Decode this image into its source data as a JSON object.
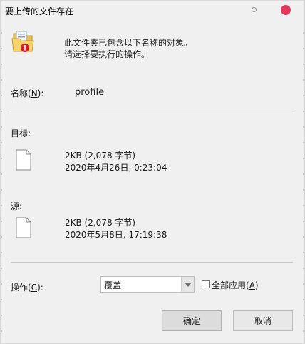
{
  "window": {
    "title": "要上传的文件存在",
    "close_color": "#e2385d"
  },
  "message": {
    "line1": "此文件夹已包含以下名称的对象。",
    "line2": "请选择要执行的操作。"
  },
  "name_row": {
    "label_prefix": "名称(",
    "label_key": "N",
    "label_suffix": "):",
    "value": "profile"
  },
  "target": {
    "label": "目标:",
    "size": "2KB (2,078 字节)",
    "date": "2020年4月26日, 0:23:04"
  },
  "source": {
    "label": "源:",
    "size": "2KB (2,078 字节)",
    "date": "2020年5月8日, 17:19:38"
  },
  "action_row": {
    "label_prefix": "操作(",
    "label_key": "C",
    "label_suffix": "):",
    "selected": "覆盖",
    "apply_all_prefix": "全部应用(",
    "apply_all_key": "A",
    "apply_all_suffix": ")",
    "apply_all_checked": false
  },
  "buttons": {
    "ok": "确定",
    "cancel": "取消"
  },
  "icons": {
    "folder": "folder-warning-icon",
    "file": "document-icon"
  }
}
